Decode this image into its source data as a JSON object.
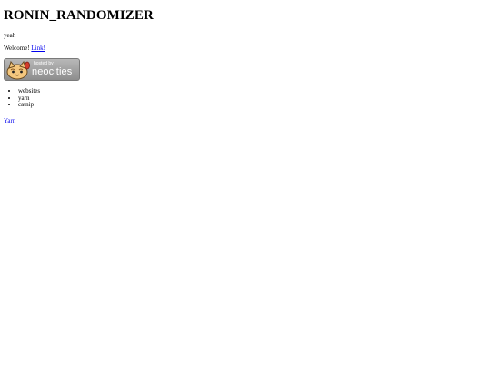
{
  "page": {
    "title": "RONIN_RANDOMIZER",
    "tagline": "yeah",
    "welcome_text": "Welcome!",
    "welcome_link": "Link!",
    "badge": {
      "hosted_label": "hosted by",
      "brand_name": "neocities"
    },
    "topics": [
      "websites",
      "yarn",
      "catnip"
    ],
    "footer_link": "Yarn"
  }
}
